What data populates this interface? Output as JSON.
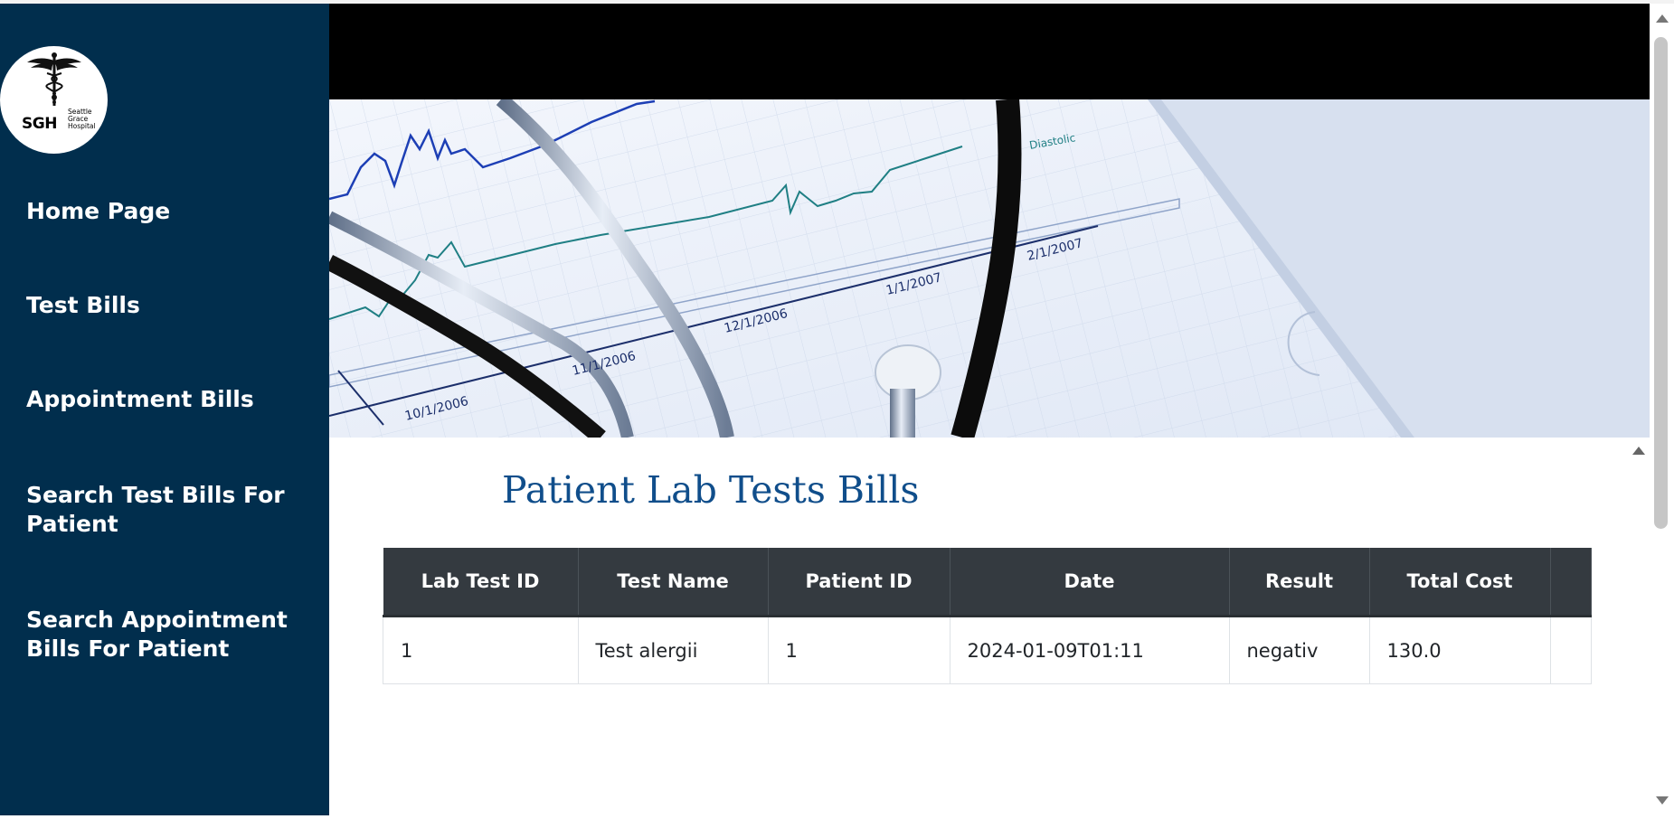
{
  "logo": {
    "abbr": "SGH",
    "name_lines": [
      "Seattle",
      "Grace",
      "Hospital"
    ]
  },
  "sidebar": {
    "items": [
      {
        "label": "Home Page"
      },
      {
        "label": "Test Bills"
      },
      {
        "label": "Appointment Bills"
      },
      {
        "label": "Search Test Bills For Patient"
      },
      {
        "label": "Search Appointment Bills For Patient"
      }
    ]
  },
  "banner": {
    "chart_labels": [
      "Diastolic",
      "10/1/2006",
      "11/1/2006",
      "12/1/2006",
      "1/1/2007",
      "2/1/2007"
    ]
  },
  "main": {
    "title": "Patient Lab Tests Bills",
    "table": {
      "headers": [
        "Lab Test ID",
        "Test Name",
        "Patient ID",
        "Date",
        "Result",
        "Total Cost",
        ""
      ],
      "rows": [
        [
          "1",
          "Test alergii",
          "1",
          "2024-01-09T01:11",
          "negativ",
          "130.0",
          ""
        ]
      ]
    }
  },
  "colors": {
    "sidebar_bg": "#012e4d",
    "title_color": "#104e8b",
    "table_header_bg": "#343a40"
  }
}
